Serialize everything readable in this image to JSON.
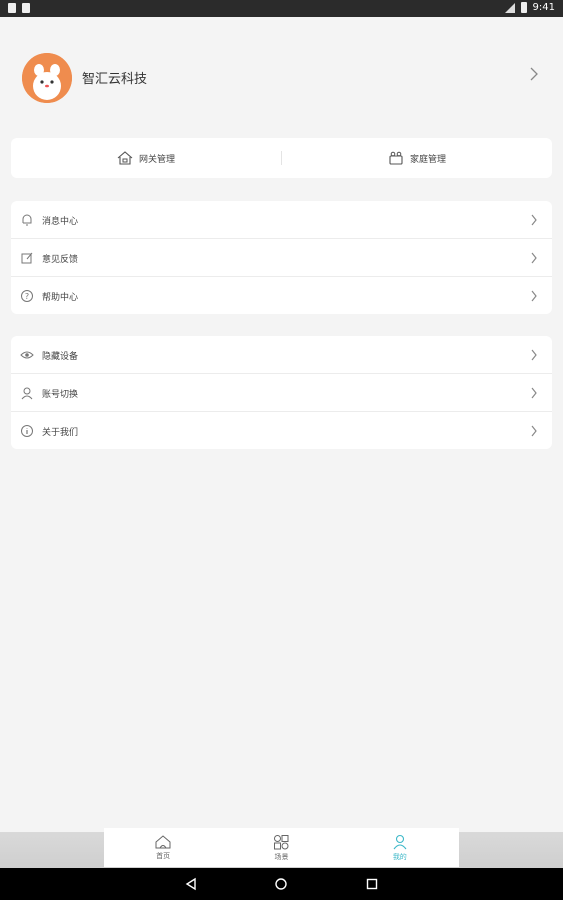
{
  "status_bar": {
    "time": "9:41"
  },
  "profile": {
    "name": "智汇云科技"
  },
  "quick_actions": [
    {
      "label": "网关管理",
      "icon": "home-gateway-icon"
    },
    {
      "label": "家庭管理",
      "icon": "family-icon"
    }
  ],
  "group1": [
    {
      "label": "消息中心",
      "icon": "bell-icon"
    },
    {
      "label": "意见反馈",
      "icon": "edit-icon"
    },
    {
      "label": "帮助中心",
      "icon": "help-icon"
    }
  ],
  "group2": [
    {
      "label": "隐藏设备",
      "icon": "eye-icon"
    },
    {
      "label": "账号切换",
      "icon": "user-switch-icon"
    },
    {
      "label": "关于我们",
      "icon": "info-icon"
    }
  ],
  "tabs": [
    {
      "label": "首页",
      "icon": "home-icon",
      "active": false
    },
    {
      "label": "场景",
      "icon": "scene-icon",
      "active": false
    },
    {
      "label": "我的",
      "icon": "profile-icon",
      "active": true
    }
  ],
  "colors": {
    "accent": "#3db8c8",
    "avatar_bg": "#ef8c4e",
    "background": "#f4f4f4"
  }
}
